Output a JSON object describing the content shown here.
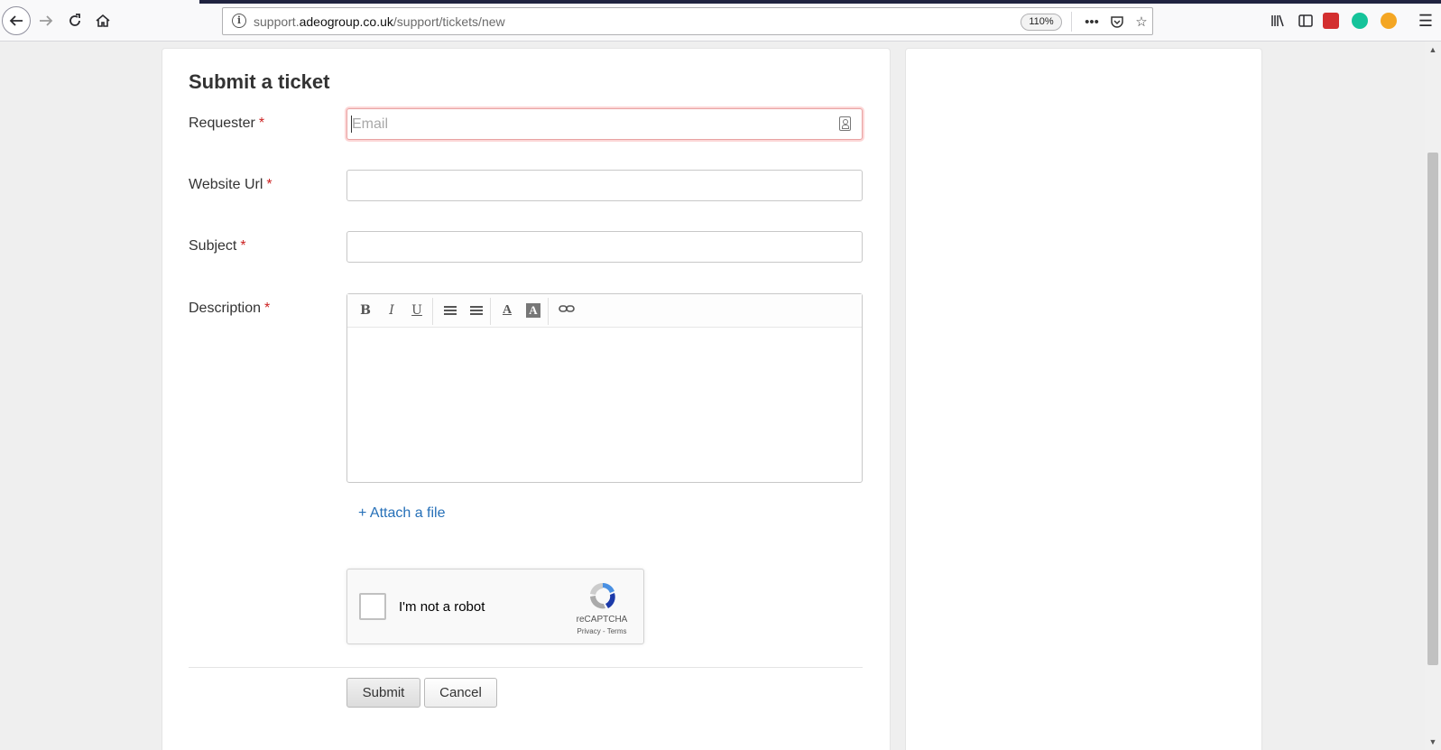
{
  "browser": {
    "url_prefix": "support.",
    "url_domain": "adeogroup.co.uk",
    "url_path": "/support/tickets/new",
    "zoom": "110%",
    "icons": {
      "back": "back-arrow-icon",
      "forward": "forward-arrow-icon",
      "reload": "reload-icon",
      "home": "home-icon",
      "info": "site-info-icon",
      "more": "more-options-icon",
      "pocket": "pocket-icon",
      "bookmark": "star-icon",
      "library": "library-icon",
      "sidebar": "sidebar-icon",
      "menu": "hamburger-menu-icon"
    },
    "extension_colors": [
      "#d32f2f",
      "#15c39a",
      "#f4a623"
    ]
  },
  "form": {
    "title": "Submit a ticket",
    "requester_label": "Requester",
    "requester_placeholder": "Email",
    "website_label": "Website Url",
    "subject_label": "Subject",
    "description_label": "Description",
    "required_mark": "*",
    "editor_tools": {
      "bold": "B",
      "italic": "I",
      "underline": "U",
      "font_color": "A",
      "bg_color": "A"
    },
    "attach_label": "+ Attach a file",
    "captcha": {
      "label": "I'm not a robot",
      "brand": "reCAPTCHA",
      "links": "Privacy - Terms"
    },
    "submit_label": "Submit",
    "cancel_label": "Cancel"
  },
  "colors": {
    "required": "#cc2222",
    "link": "#2670b8",
    "focus_border": "#e8a2a2"
  }
}
